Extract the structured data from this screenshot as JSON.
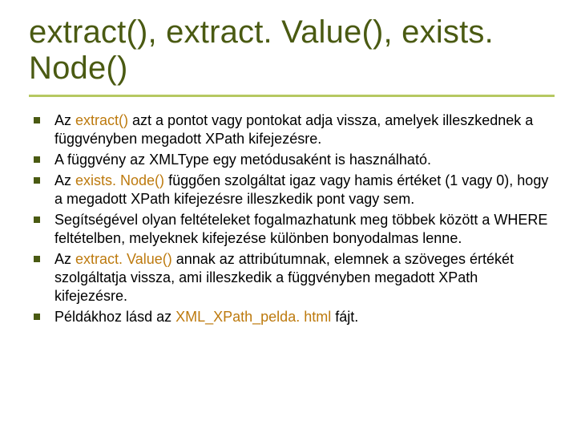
{
  "title": "extract(), extract. Value(), exists. Node()",
  "bullets": [
    {
      "pre": "Az ",
      "kw": "extract()",
      "post": " azt a pontot vagy pontokat adja vissza, amelyek illeszkednek a függvényben megadott XPath kifejezésre."
    },
    {
      "pre": "A függvény az XMLType egy metódusaként is használható.",
      "kw": "",
      "post": ""
    },
    {
      "pre": "Az ",
      "kw": "exists. Node()",
      "post": " függően szolgáltat igaz vagy hamis értéket (1 vagy 0), hogy a megadott XPath kifejezésre illeszkedik pont vagy sem."
    },
    {
      "pre": "Segítségével olyan feltételeket fogalmazhatunk meg többek között a WHERE feltételben, melyeknek kifejezése különben bonyodalmas lenne.",
      "kw": "",
      "post": ""
    },
    {
      "pre": "Az ",
      "kw": "extract. Value()",
      "post": " annak az attribútumnak, elemnek a szöveges értékét szolgáltatja vissza, ami illeszkedik a függvényben megadott XPath kifejezésre."
    },
    {
      "pre": "Példákhoz lásd az ",
      "kw": "XML_XPath_pelda. html",
      "post": " fájt."
    }
  ]
}
